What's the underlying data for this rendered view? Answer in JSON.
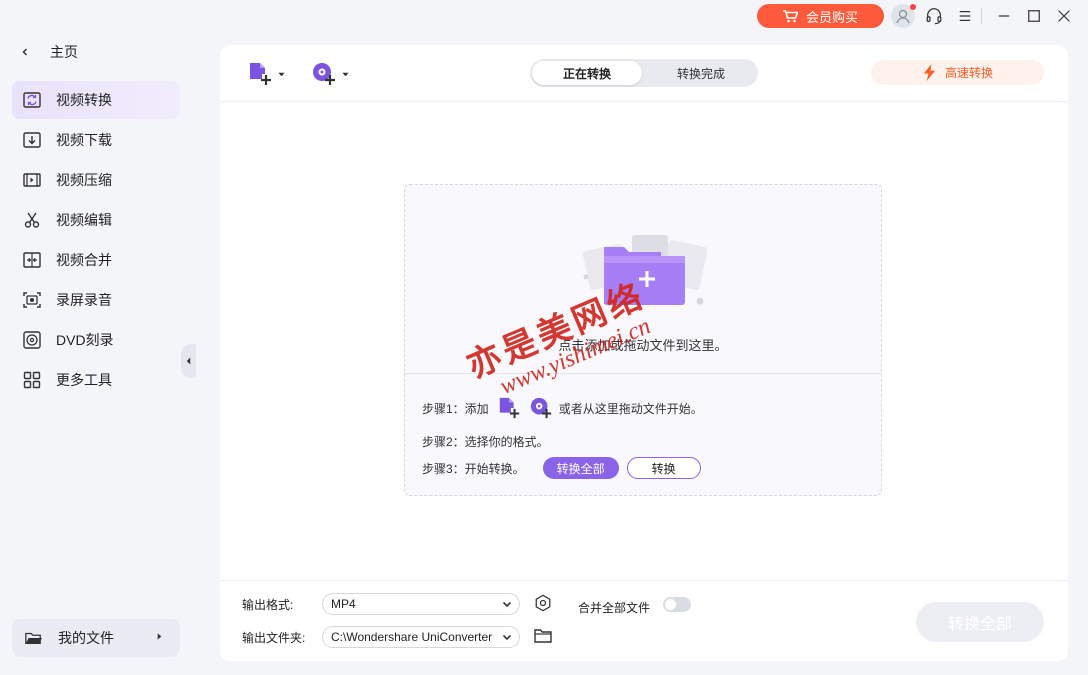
{
  "titlebar": {
    "vip_label": "会员购买",
    "icons": [
      "cart-icon",
      "avatar",
      "headset-icon",
      "menu-icon",
      "minimize-icon",
      "maximize-icon",
      "close-icon"
    ]
  },
  "sidebar": {
    "home_label": "主页",
    "items": [
      {
        "label": "视频转换",
        "icon": "convert-icon",
        "active": true
      },
      {
        "label": "视频下载",
        "icon": "download-icon",
        "active": false
      },
      {
        "label": "视频压缩",
        "icon": "compress-icon",
        "active": false
      },
      {
        "label": "视频编辑",
        "icon": "scissors-icon",
        "active": false
      },
      {
        "label": "视频合并",
        "icon": "merge-icon",
        "active": false
      },
      {
        "label": "录屏录音",
        "icon": "record-icon",
        "active": false
      },
      {
        "label": "DVD刻录",
        "icon": "dvd-icon",
        "active": false
      },
      {
        "label": "更多工具",
        "icon": "grid-icon",
        "active": false
      }
    ],
    "my_files_label": "我的文件"
  },
  "toolbar": {
    "tabs": [
      "正在转换",
      "转换完成"
    ],
    "active_tab": 0,
    "fast_label": "高速转换",
    "accent": "#8a63e8",
    "fast_color": "#ff5a1f"
  },
  "dropzone": {
    "hint": "点击添加或拖动文件到这里。",
    "step1_prefix": "步骤1：添加",
    "step1_suffix": "或者从这里拖动文件开始。",
    "step2": "步骤2：选择你的格式。",
    "step3_prefix": "步骤3：开始转换。",
    "convert_all_btn": "转换全部",
    "convert_btn": "转换"
  },
  "watermark": {
    "cn": "亦是美网络",
    "url": "www.yishimei.cn"
  },
  "bottom": {
    "format_label": "输出格式:",
    "format_value": "MP4",
    "folder_label": "输出文件夹:",
    "folder_value": "C:\\Wondershare UniConverter",
    "merge_label": "合并全部文件",
    "merge_enabled": false,
    "convert_all_label": "转换全部"
  }
}
